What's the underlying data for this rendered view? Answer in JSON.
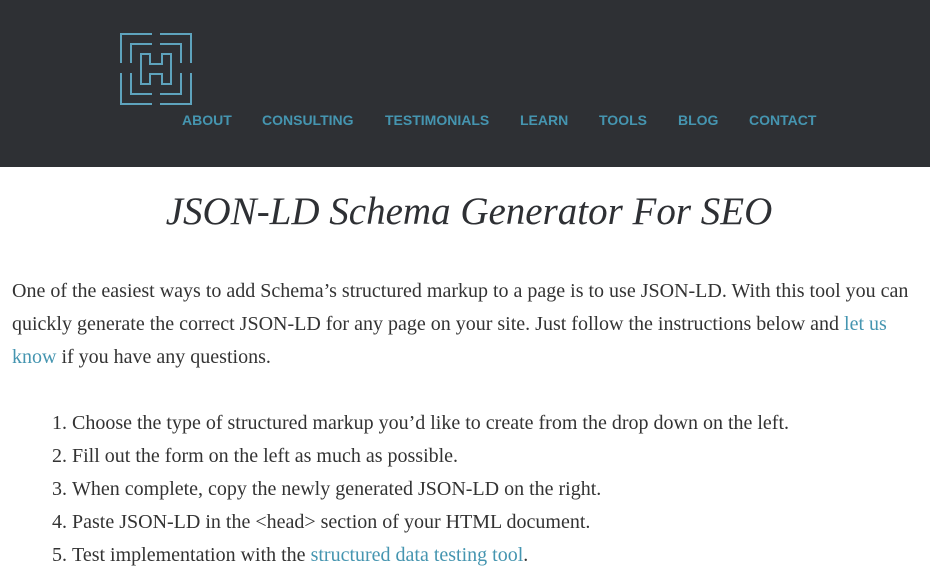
{
  "header": {
    "logo_icon": "maze-h-logo-icon",
    "nav": [
      {
        "label": "ABOUT"
      },
      {
        "label": "CONSULTING"
      },
      {
        "label": "TESTIMONIALS"
      },
      {
        "label": "LEARN"
      },
      {
        "label": "TOOLS"
      },
      {
        "label": "BLOG"
      },
      {
        "label": "CONTACT"
      }
    ]
  },
  "main": {
    "title": "JSON-LD Schema Generator For SEO",
    "intro": {
      "text_before_link": "One of the easiest ways to add Schema’s structured markup to a page is to use JSON-LD. With this tool you can quickly generate the correct JSON-LD for any page on your site. Just follow the instructions below and ",
      "link_text": "let us know",
      "text_after_link": " if you have any questions."
    },
    "steps": [
      {
        "text": "Choose the type of structured markup you’d like to create from the drop down on the left."
      },
      {
        "text": "Fill out the form on the left as much as possible."
      },
      {
        "text": "When complete, copy the newly generated JSON-LD on the right."
      },
      {
        "text": "Paste JSON-LD in the <head> section of your HTML document."
      },
      {
        "text_before_link": "Test implementation with the ",
        "link_text": "structured data testing tool",
        "text_after_link": "."
      }
    ]
  },
  "colors": {
    "header_bg": "#2e3034",
    "accent": "#4595b0",
    "body_text": "#333333",
    "title_text": "#2e3034"
  }
}
